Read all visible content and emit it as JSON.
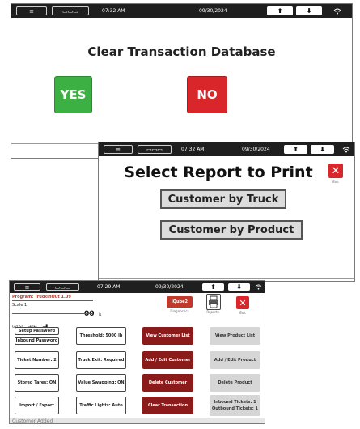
{
  "colors": {
    "statusbar": "#1f1f1f",
    "yes": "#3cb043",
    "no": "#d9262b",
    "dark_red": "#8b1a1a",
    "accent_red": "#c0392b"
  },
  "screen1": {
    "status": {
      "left_icon": "≡",
      "box_glyph": "▭▭▭",
      "time": "07:32 AM",
      "date": "09/30/2024",
      "up": "⬆",
      "down": "⬇",
      "wifi": "wifi-icon"
    },
    "title": "Clear Transaction Database",
    "yes_label": "YES",
    "no_label": "NO"
  },
  "screen2": {
    "status": {
      "left_icon": "≡",
      "box_glyph": "▭▭▭",
      "time": "07:32 AM",
      "date": "09/30/2024",
      "up": "⬆",
      "down": "⬇",
      "wifi": "wifi-icon"
    },
    "title": "Select Report to Print",
    "exit_label": "Exit",
    "options": [
      "Customer by Truck",
      "Customer by Product"
    ]
  },
  "screen3": {
    "status": {
      "left_icon": "≡",
      "box_glyph": "▭▭▭",
      "time": "07:29 AM",
      "date": "09/30/2024",
      "up": "⬆",
      "down": "⬇",
      "wifi": "wifi-icon"
    },
    "program": "Program: TruckInOut 1.09",
    "scale": "Scale 1",
    "weight_value": "00",
    "weight_unit": "lb",
    "gross_label": "GROSS",
    "iqube_label": "iQube2",
    "diagnostics_label": "Diagnostics",
    "reports_label": "Reports",
    "exit_label": "Exit",
    "setup_password": "Setup Password",
    "inbound_password": "Inbound Password",
    "threshold": "Threshold: 5000 lb",
    "view_customer_list": "View Customer List",
    "view_product_list": "View Product List",
    "ticket_number": "Ticket Number: 2",
    "truck_exit": "Truck Exit: Required",
    "add_edit_customer": "Add / Edit Customer",
    "add_edit_product": "Add / Edit Product",
    "stored_tares": "Stored Tares: ON",
    "value_swapping": "Value Swapping: ON",
    "delete_customer": "Delete Customer",
    "delete_product": "Delete Product",
    "import_export": "Import / Export",
    "traffic_lights": "Traffic Lights: Auto",
    "clear_transaction": "Clear Transaction",
    "inbound_tickets": "Inbound Tickets: 1",
    "outbound_tickets": "Outbound Tickets: 1",
    "footer_status": "Customer Added"
  }
}
